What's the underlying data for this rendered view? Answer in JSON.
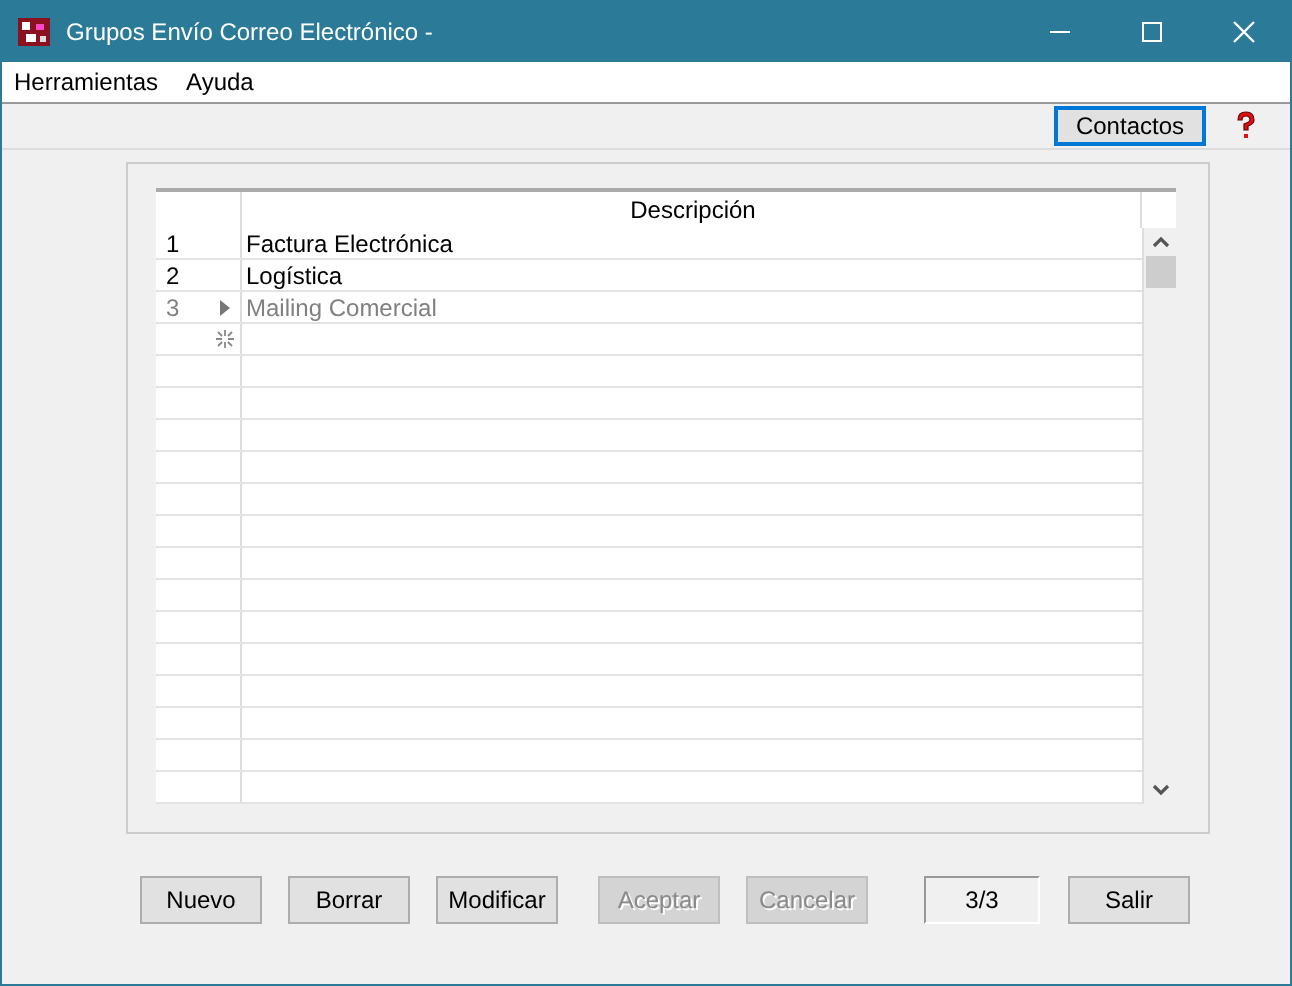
{
  "window": {
    "title": "Grupos Envío Correo Electrónico -"
  },
  "menu": [
    "Herramientas",
    "Ayuda"
  ],
  "toolbar": {
    "button": "Contactos"
  },
  "grid": {
    "columns": [
      "Descripción"
    ],
    "rows": [
      {
        "number": "1",
        "description": "Factura Electrónica",
        "selected": false
      },
      {
        "number": "2",
        "description": "Logística",
        "selected": false
      },
      {
        "number": "3",
        "description": "Mailing Comercial",
        "selected": true
      }
    ]
  },
  "buttons": [
    {
      "label": "Nuevo",
      "disabled": false
    },
    {
      "label": "Borrar",
      "disabled": false
    },
    {
      "label": "Modificar",
      "disabled": false
    },
    {
      "label": "Aceptar",
      "disabled": true
    },
    {
      "label": "Cancelar",
      "disabled": true
    }
  ],
  "counter": "3/3",
  "exit_button": "Salir"
}
